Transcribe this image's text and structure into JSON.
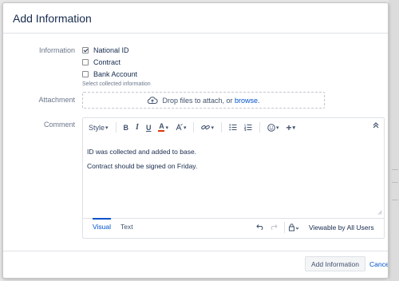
{
  "dialog": {
    "title": "Add Information",
    "submit_label": "Add Information",
    "cancel_label": "Cancel"
  },
  "information": {
    "label": "Information",
    "options": [
      {
        "label": "National ID",
        "checked": true
      },
      {
        "label": "Contract",
        "checked": false
      },
      {
        "label": "Bank Account",
        "checked": false
      }
    ],
    "hint": "Select collected information"
  },
  "attachment": {
    "label": "Attachment",
    "drop_text": "Drop files to attach, or",
    "browse_link": "browse."
  },
  "comment": {
    "label": "Comment",
    "toolbar": {
      "style_label": "Style",
      "bold": "B",
      "italic": "I",
      "underline": "U",
      "text_color": "A",
      "more": "+",
      "collapse": "»"
    },
    "lines": [
      "ID was collected and added to base.",
      "Contract should be signed on Friday."
    ],
    "tabs": [
      "Visual",
      "Text"
    ],
    "visibility": "Viewable by All Users"
  }
}
